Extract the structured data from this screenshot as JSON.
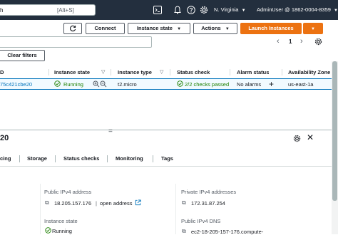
{
  "nav": {
    "search_placeholder_partial": "h",
    "search_shortcut": "[Alt+S]",
    "region": "N. Virginia",
    "account": "AdminUser @ 1862-0004-8359",
    "icons": [
      "terminal-icon",
      "bell-icon",
      "help-icon",
      "settings-icon"
    ]
  },
  "toolbar": {
    "connect": "Connect",
    "instance_state": "Instance state",
    "actions": "Actions",
    "launch_instances": "Launch Instances",
    "page_number": "1",
    "clear_filters": "Clear filters"
  },
  "table": {
    "columns": {
      "id": "D",
      "instance_state": "Instance state",
      "instance_type": "Instance type",
      "status_check": "Status check",
      "alarm_status": "Alarm status",
      "availability_zone": "Availability Zone"
    },
    "row": {
      "id_partial": "75c421cbe20",
      "state": "Running",
      "type": "t2.micro",
      "status_check": "2/2 checks passed",
      "alarm_status": "No alarms",
      "zone": "us-east-1a"
    }
  },
  "detail": {
    "header_partial": "20",
    "tabs": [
      "cing",
      "Storage",
      "Status checks",
      "Monitoring",
      "Tags"
    ],
    "public_ipv4_label": "Public IPv4 address",
    "public_ipv4_value": "18.205.157.176",
    "open_address": "open address",
    "private_ipv4_label": "Private IPv4 addresses",
    "private_ipv4_value": "172.31.87.254",
    "instance_state_label": "Instance state",
    "instance_state_value": "Running",
    "public_dns_label": "Public IPv4 DNS",
    "public_dns_value": "ec2-18-205-157-176.compute-"
  },
  "colors": {
    "nav_bg": "#232f3e",
    "primary": "#ec7211",
    "link": "#0073bb",
    "success": "#1d8102",
    "selected_row": "#f1faff"
  }
}
